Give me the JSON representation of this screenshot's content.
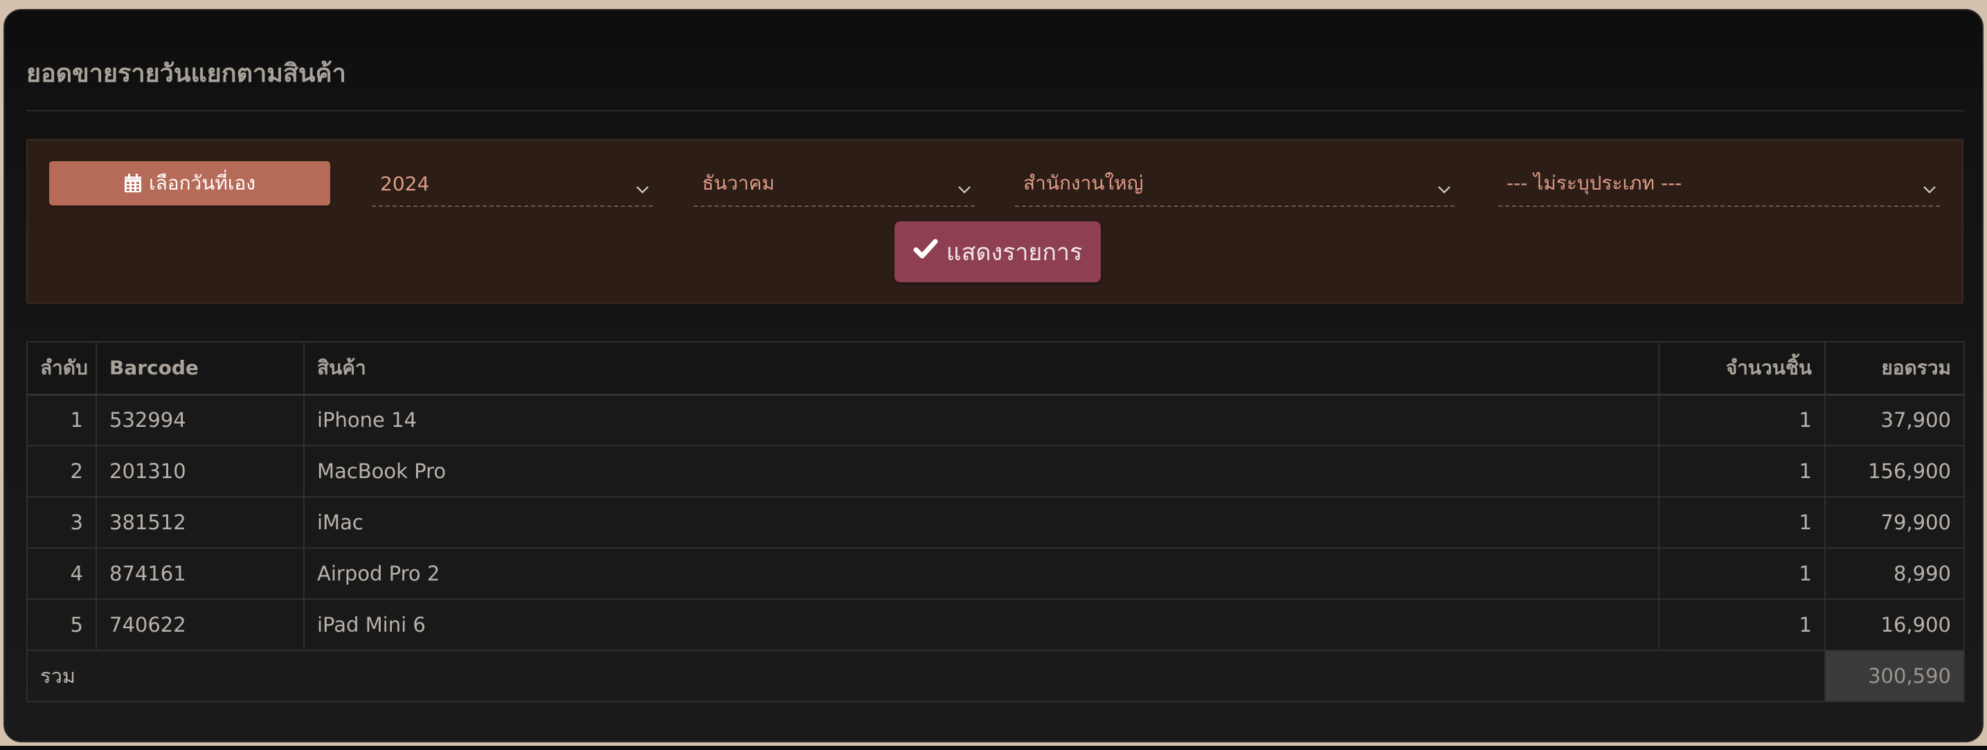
{
  "page": {
    "title": "ยอดขายรายวันแยกตามสินค้า"
  },
  "filters": {
    "pick_date_label": "เลือกวันที่เอง",
    "year": "2024",
    "month": "ธันวาคม",
    "branch": "สำนักงานใหญ่",
    "type": "--- ไม่ระบุประเภท ---",
    "show_label": "แสดงรายการ"
  },
  "table": {
    "headers": {
      "no": "ลำดับ",
      "barcode": "Barcode",
      "product": "สินค้า",
      "qty": "จำนวนชิ้น",
      "total": "ยอดรวม"
    },
    "rows": [
      {
        "no": "1",
        "barcode": "532994",
        "product": "iPhone 14",
        "qty": "1",
        "total": "37,900"
      },
      {
        "no": "2",
        "barcode": "201310",
        "product": "MacBook Pro",
        "qty": "1",
        "total": "156,900"
      },
      {
        "no": "3",
        "barcode": "381512",
        "product": "iMac",
        "qty": "1",
        "total": "79,900"
      },
      {
        "no": "4",
        "barcode": "874161",
        "product": "Airpod Pro 2",
        "qty": "1",
        "total": "8,990"
      },
      {
        "no": "5",
        "barcode": "740622",
        "product": "iPad Mini 6",
        "qty": "1",
        "total": "16,900"
      }
    ],
    "footer": {
      "label": "รวม",
      "total": "300,590"
    }
  },
  "colors": {
    "accent_button": "#b66b58",
    "show_button": "#8e4052",
    "filter_text": "#e09b87"
  },
  "icons": {
    "pick_date": "calendar-icon",
    "show": "check-icon",
    "dropdown": "chevron-down-icon"
  }
}
